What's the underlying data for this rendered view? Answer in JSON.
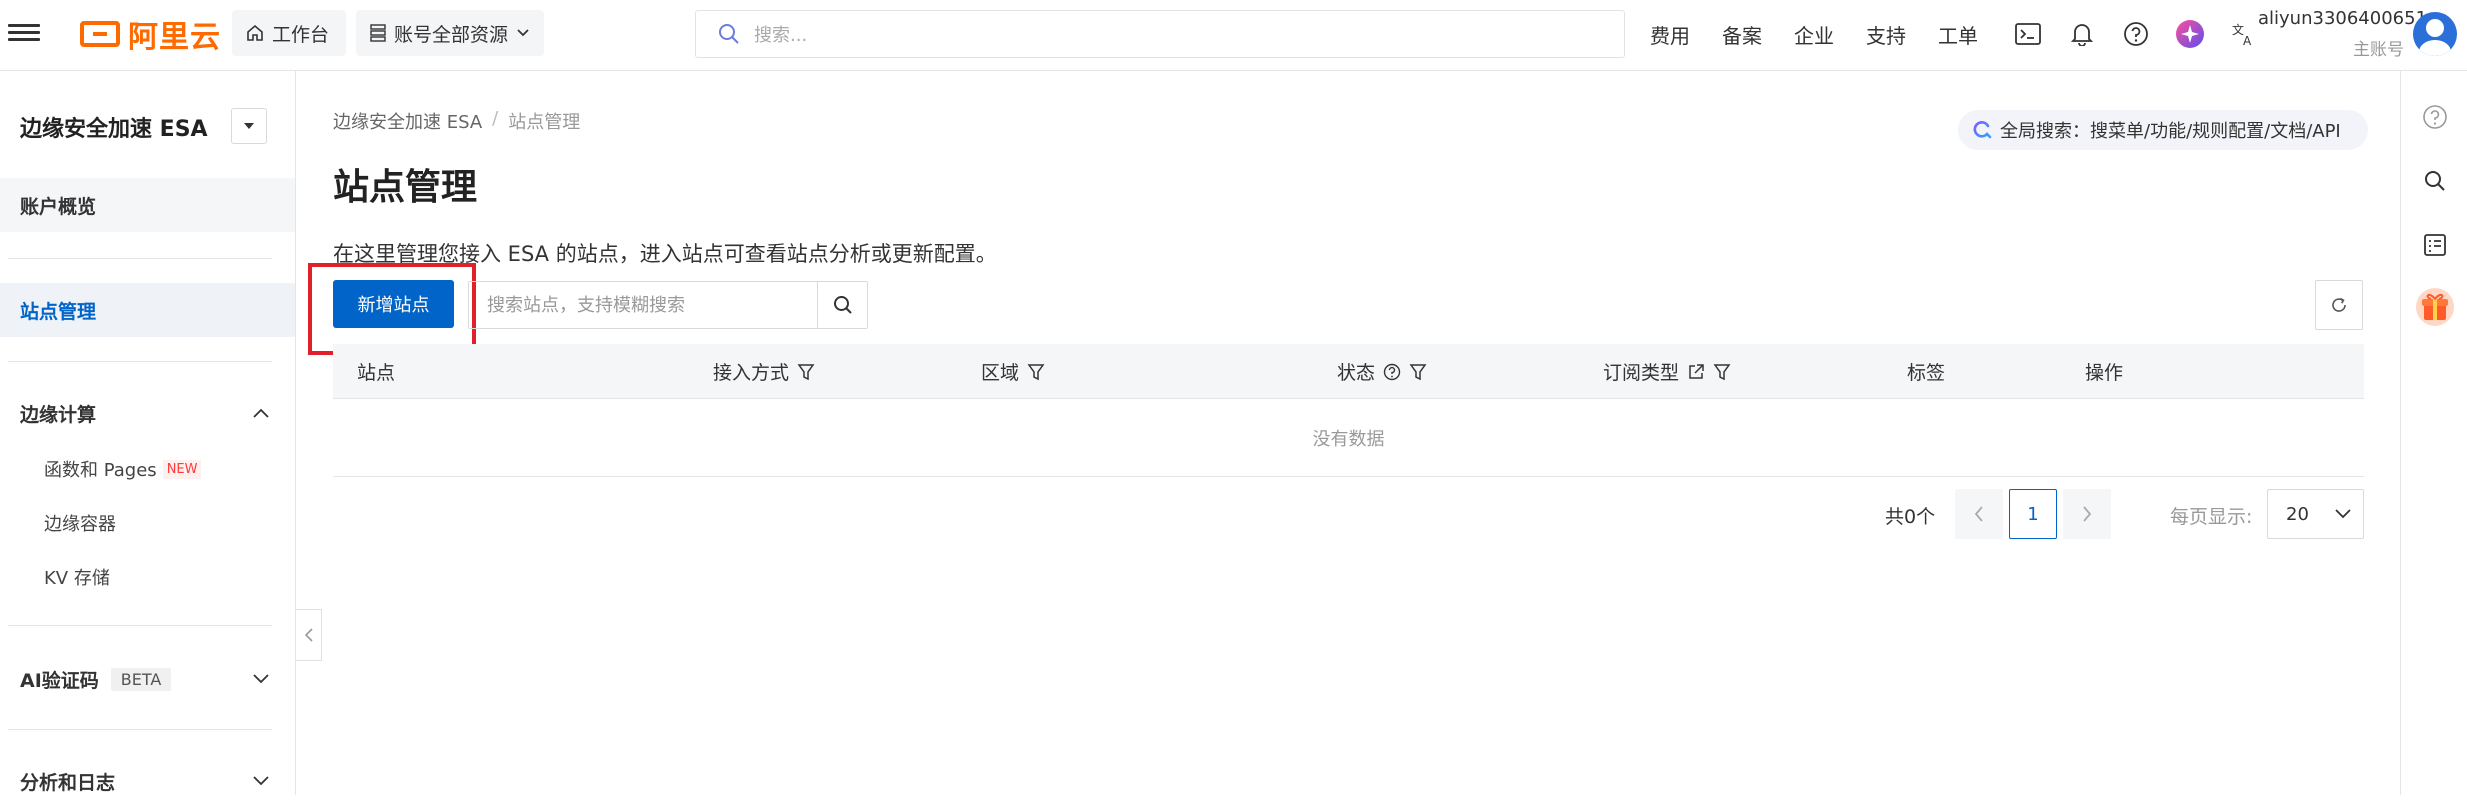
{
  "topbar": {
    "logo_text": "阿里云",
    "workbench_label": "工作台",
    "resource_label": "账号全部资源",
    "search_placeholder": "搜索...",
    "nav": [
      "费用",
      "备案",
      "企业",
      "支持",
      "工单"
    ],
    "icons": [
      "terminal-icon",
      "bell-icon",
      "help-icon",
      "ai-assistant-icon",
      "translate-icon"
    ],
    "user_name": "aliyun3306400651",
    "user_type": "主账号"
  },
  "sidebar": {
    "title": "边缘安全加速 ESA",
    "overview": "账户概览",
    "site_management": "站点管理",
    "edge_compute": "边缘计算",
    "functions_pages": "函数和 Pages",
    "new_tag": "NEW",
    "edge_container": "边缘容器",
    "kv_storage": "KV 存储",
    "ai_captcha": "AI验证码",
    "beta_tag": "BETA",
    "analytics_logs": "分析和日志"
  },
  "main": {
    "breadcrumb": [
      "边缘安全加速 ESA",
      "站点管理"
    ],
    "breadcrumb_sep": "/",
    "global_search": "全局搜索：搜菜单/功能/规则配置/文档/API",
    "title": "站点管理",
    "description": "在这里管理您接入 ESA 的站点，进入站点可查看站点分析或更新配置。",
    "add_site_button": "新增站点",
    "search_placeholder": "搜索站点，支持模糊搜索",
    "columns": {
      "site": "站点",
      "access_method": "接入方式",
      "region": "区域",
      "status": "状态",
      "subscription": "订阅类型",
      "tags": "标签",
      "actions": "操作"
    },
    "empty_text": "没有数据",
    "pagination": {
      "total": "共0个",
      "current_page": "1",
      "page_size_label": "每页显示:",
      "page_size": "20"
    }
  },
  "colors": {
    "brand_orange": "#ff6a00",
    "primary_blue": "#0064c8",
    "highlight_red": "#e0202a"
  }
}
